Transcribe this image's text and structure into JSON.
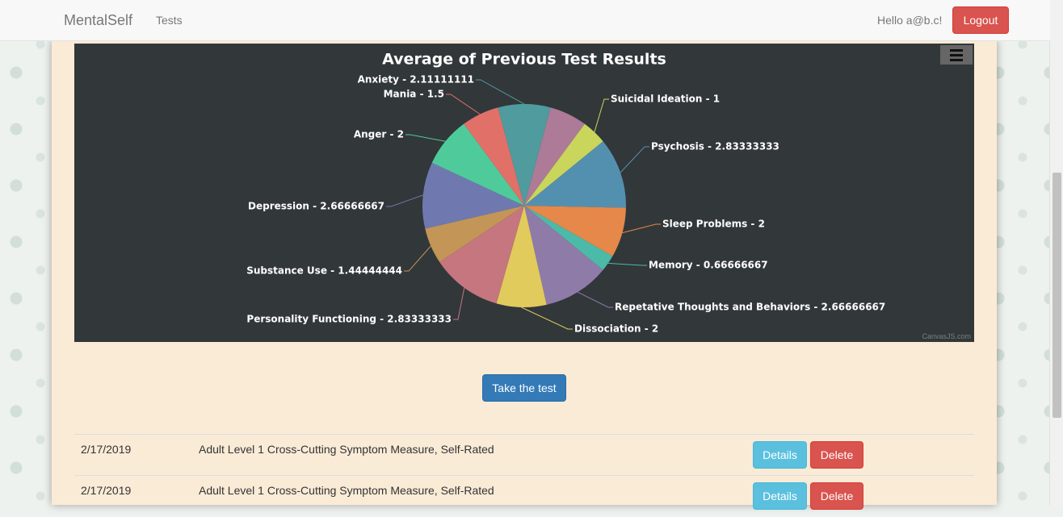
{
  "nav": {
    "brand": "MentalSelf",
    "tests_link": "Tests",
    "greeting": "Hello a@b.c!",
    "logout": "Logout"
  },
  "chart_data": {
    "type": "pie",
    "title": "Average of Previous Test Results",
    "credit": "CanvasJS.com",
    "slices": [
      {
        "label": "Anxiety",
        "value": 2.11111111,
        "color": "#4f9b9e"
      },
      {
        "label": "Mania",
        "value": 1.5,
        "color": "#ad7a98"
      },
      {
        "label": "Suicidal Ideation",
        "value": 1,
        "color": "#c9d55b"
      },
      {
        "label": "Psychosis",
        "value": 2.83333333,
        "color": "#5390b0"
      },
      {
        "label": "Sleep Problems",
        "value": 2,
        "color": "#e5884a"
      },
      {
        "label": "Memory",
        "value": 0.66666667,
        "color": "#4cbaa8"
      },
      {
        "label": "Repetative Thoughts and Behaviors",
        "value": 2.66666667,
        "color": "#8f7ba8"
      },
      {
        "label": "Dissociation",
        "value": 2,
        "color": "#e0cb5c"
      },
      {
        "label": "Personality Functioning",
        "value": 2.83333333,
        "color": "#c5767e"
      },
      {
        "label": "Substance Use",
        "value": 1.44444444,
        "color": "#c39557"
      },
      {
        "label": "Depression",
        "value": 2.66666667,
        "color": "#6f79b0"
      },
      {
        "label": "Anger",
        "value": 2,
        "color": "#4fcb9b"
      },
      {
        "label": "Mania",
        "value": 1.5,
        "color": "#e17069"
      }
    ],
    "visible_labels": [
      "Anxiety - 2.11111111",
      "Mania - 1.5",
      "Suicidal Ideation - 1",
      "Psychosis - 2.83333333",
      "Sleep Problems - 2",
      "Memory - 0.66666667",
      "Repetative Thoughts and Behaviors - 2.66666667",
      "Dissociation - 2",
      "Personality Functioning - 2.83333333",
      "Substance Use - 1.44444444",
      "Depression - 2.66666667",
      "Anger - 2"
    ]
  },
  "actions": {
    "take_test": "Take the test"
  },
  "results": [
    {
      "date": "2/17/2019",
      "name": "Adult Level 1 Cross-Cutting Symptom Measure, Self-Rated",
      "details": "Details",
      "delete": "Delete"
    },
    {
      "date": "2/17/2019",
      "name": "Adult Level 1 Cross-Cutting Symptom Measure, Self-Rated",
      "details": "Details",
      "delete": "Delete"
    }
  ]
}
